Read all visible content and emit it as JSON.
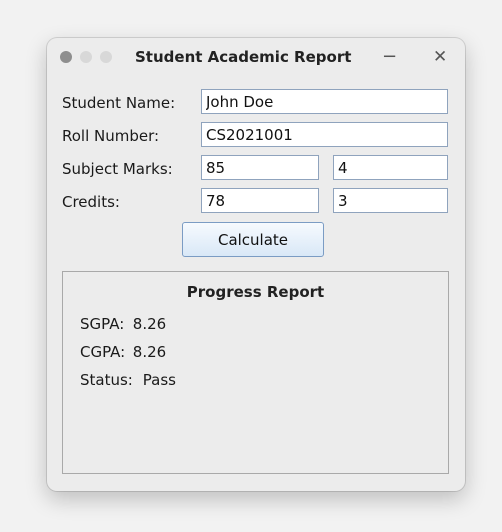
{
  "window": {
    "title": "Student Academic Report",
    "minimize_glyph": "−",
    "close_glyph": "✕"
  },
  "form": {
    "student_name_label": "Student Name:",
    "student_name_value": "John Doe",
    "roll_number_label": "Roll Number:",
    "roll_number_value": "CS2021001",
    "subject_marks_label": "Subject Marks:",
    "subject_marks_value": "85",
    "subject_marks_credit": "4",
    "credits_label": "Credits:",
    "credits_value": "78",
    "credits_credit": "3",
    "calculate_label": "Calculate"
  },
  "report": {
    "title": "Progress Report",
    "sgpa_label": "SGPA:",
    "sgpa_value": "8.26",
    "cgpa_label": "CGPA:",
    "cgpa_value": "8.26",
    "status_label": "Status:",
    "status_value": "Pass"
  }
}
